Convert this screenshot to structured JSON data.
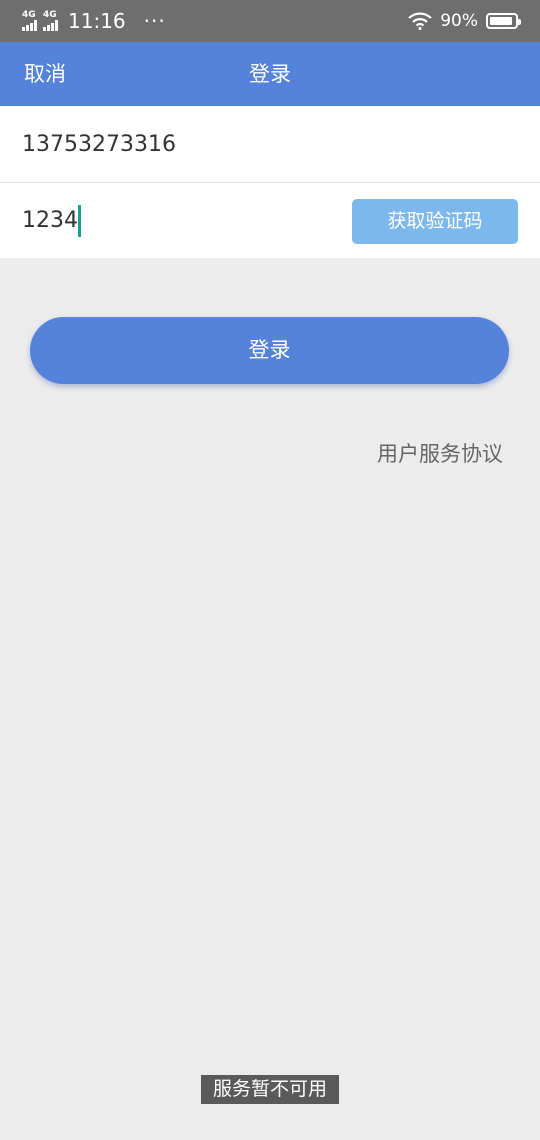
{
  "status_bar": {
    "signal_1": "4G",
    "signal_2": "4G",
    "time": "11:16",
    "more": "···",
    "battery_text": "90%",
    "battery_level": 0.9,
    "icons": [
      "signal-icon",
      "wifi-icon",
      "battery-icon"
    ]
  },
  "nav": {
    "cancel_label": "取消",
    "title": "登录",
    "background": "#5583da"
  },
  "form": {
    "phone_value": "13753273316",
    "code_value": "1234",
    "get_code_label": "获取验证码"
  },
  "login_button_label": "登录",
  "agreement_link": "用户服务协议",
  "toast": "服务暂不可用",
  "colors": {
    "accent": "#5583da",
    "code_button": "#7db8ec",
    "page_background": "#ececec"
  }
}
